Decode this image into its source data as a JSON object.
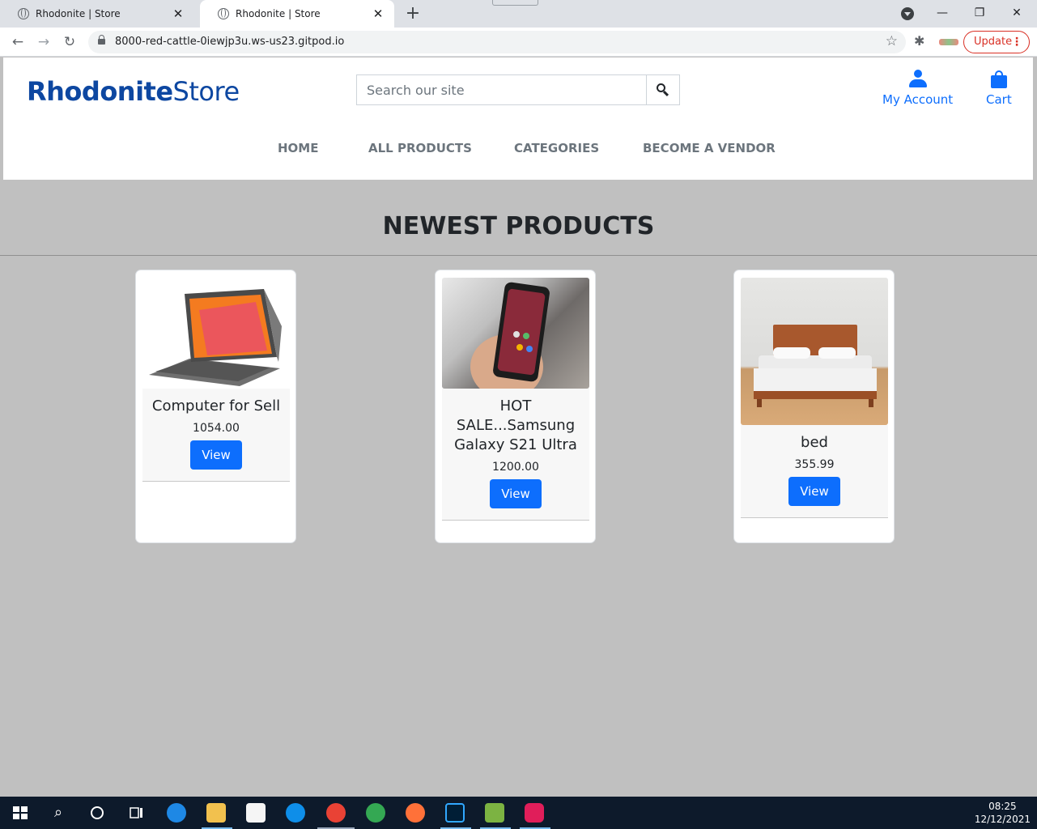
{
  "browser": {
    "tabs": [
      {
        "title": "Rhodonite | Store"
      },
      {
        "title": "Rhodonite | Store"
      }
    ],
    "url": "8000-red-cattle-0iewjp3u.ws-us23.gitpod.io",
    "update_label": "Update"
  },
  "site": {
    "logo_bold": "Rhodonite",
    "logo_light": "Store",
    "search_placeholder": "Search our site",
    "account_label": "My Account",
    "cart_label": "Cart",
    "nav": [
      "HOME",
      "ALL PRODUCTS",
      "CATEGORIES",
      "BECOME A VENDOR"
    ],
    "section_title": "NEWEST PRODUCTS",
    "products": [
      {
        "name": "Computer for Sell",
        "price": "1054.00",
        "button": "View"
      },
      {
        "name": "HOT SALE...Samsung Galaxy S21 Ultra",
        "price": "1200.00",
        "button": "View"
      },
      {
        "name": "bed",
        "price": "355.99",
        "button": "View"
      }
    ],
    "colors": {
      "brand": "#0d47a1",
      "primary": "#0d6efd",
      "page_bg": "#c0c0c0"
    }
  },
  "taskbar": {
    "time": "08:25",
    "date": "12/12/2021"
  }
}
